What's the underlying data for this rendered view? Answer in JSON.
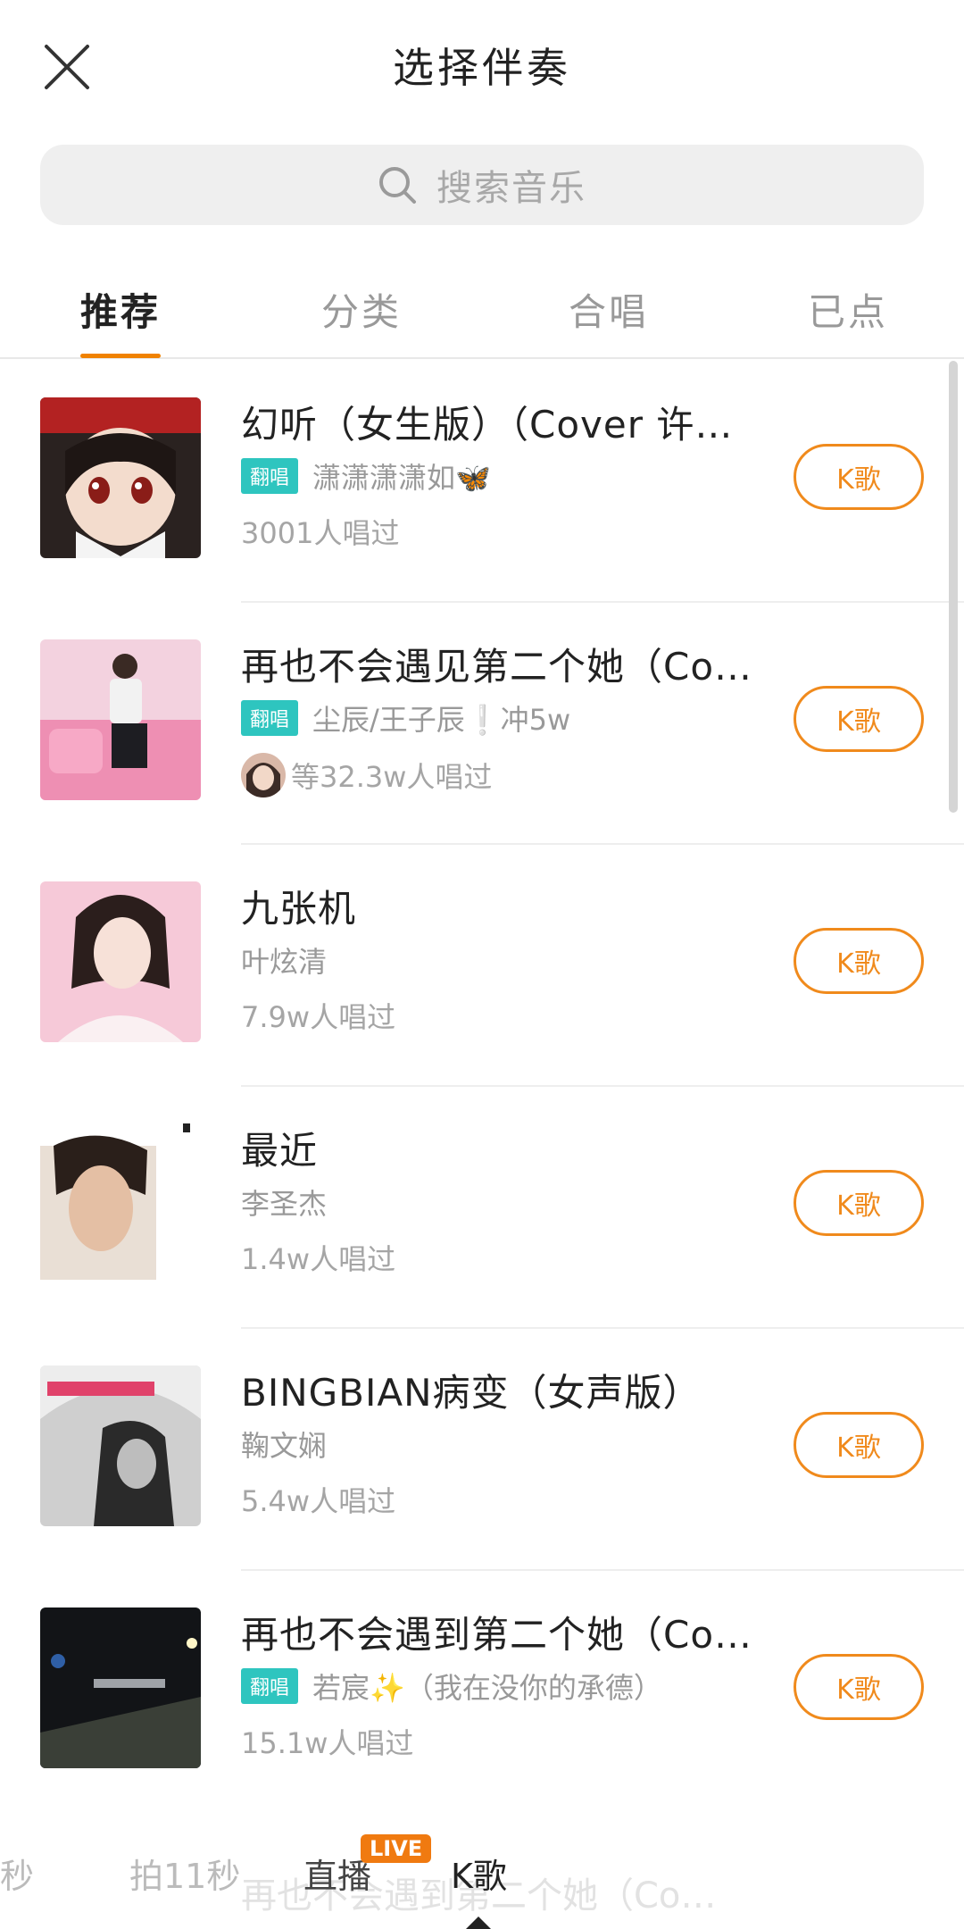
{
  "header": {
    "title": "选择伴奏"
  },
  "search": {
    "placeholder": "搜索音乐"
  },
  "tabs": [
    "推荐",
    "分类",
    "合唱",
    "已点"
  ],
  "songs": [
    {
      "title": "幻听（女生版）（Cover 许…",
      "badge": "翻唱",
      "artist": "潇潇潇潇如🦋",
      "count": "3001人唱过",
      "button": "K歌"
    },
    {
      "title": "再也不会遇见第二个她（Co…",
      "badge": "翻唱",
      "artist": "尘辰/王子辰❕冲5w",
      "count": "等32.3w人唱过",
      "button": "K歌"
    },
    {
      "title": "九张机",
      "artist": "叶炫清",
      "count": "7.9w人唱过",
      "button": "K歌"
    },
    {
      "title": "最近",
      "artist": "李圣杰",
      "count": "1.4w人唱过",
      "button": "K歌"
    },
    {
      "title": "BINGBIAN病变（女声版）",
      "artist": "鞠文娴",
      "count": "5.4w人唱过",
      "button": "K歌"
    },
    {
      "title": "再也不会遇到第二个她（Co…",
      "badge": "翻唱",
      "artist": "若宸✨（我在没你的承德）",
      "count": "15.1w人唱过",
      "button": "K歌"
    }
  ],
  "ghost_title": "再也不会遇到第二个她（Co…",
  "bottom_nav": {
    "item1": "秒",
    "item2": "拍11秒",
    "item3": "直播",
    "item4": "K歌",
    "live": "LIVE"
  },
  "colors": {
    "accent": "#f08a1c",
    "badge": "#2ec5bf",
    "live": "#f07a10"
  }
}
